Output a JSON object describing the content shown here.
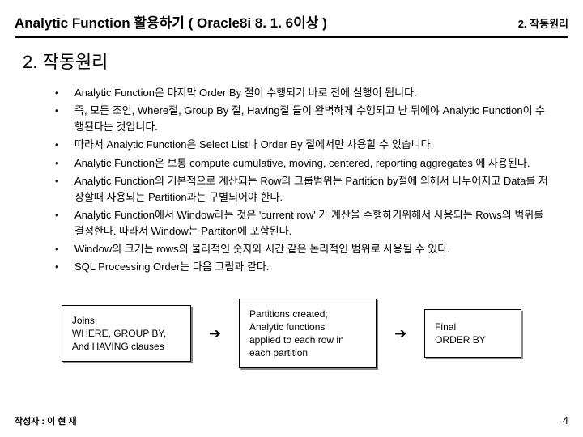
{
  "header": {
    "title": "Analytic Function 활용하기 ( Oracle8i 8. 1. 6이상 )",
    "right": "2. 작동원리"
  },
  "section_title": "2. 작동원리",
  "bullets": [
    "Analytic Function은 마지막 Order By 절이 수행되기 바로 전에 실행이 됩니다.",
    "즉, 모든 조인, Where절, Group By 절, Having절 들이 완벽하게 수행되고 난 뒤에야 Analytic Function이 수행된다는 것입니다.",
    "따라서 Analytic Function은 Select List나 Order By 절에서만 사용할 수 있습니다.",
    "Analytic Function은 보통 compute cumulative, moving, centered, reporting aggregates 에 사용된다.",
    "Analytic Function의 기본적으로 계산되는 Row의 그룹범위는 Partition by절에 의해서 나누어지고 Data를 저장할때 사용되는 Partition과는 구별되어야 한다.",
    "Analytic Function에서 Window라는 것은 'current row' 가 계산을 수행하기위해서 사용되는 Rows의 범위를 결정한다. 따라서 Window는 Partiton에 포함된다.",
    "Window의 크기는 rows의 물리적인 숫자와 시간 같은 논리적인 범위로 사용될 수 있다.",
    "SQL Processing Order는 다음 그림과 같다."
  ],
  "diagram": {
    "box1": "Joins,\nWHERE, GROUP BY,\nAnd HAVING clauses",
    "box2": "Partitions created;\nAnalytic functions\napplied to each row in\neach partition",
    "box3": "Final\nORDER BY"
  },
  "footer": {
    "left": "작성자 : 이 현 재",
    "page": "4"
  }
}
